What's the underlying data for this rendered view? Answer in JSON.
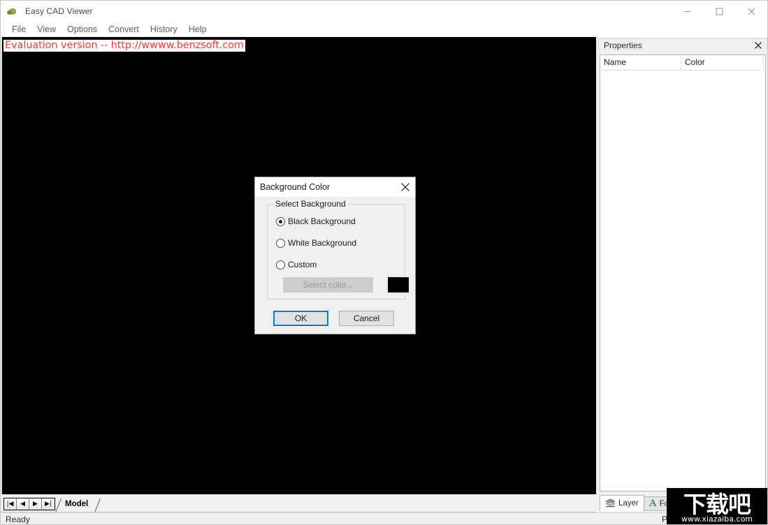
{
  "window": {
    "title": "Easy CAD Viewer",
    "icon": "turtle-icon",
    "controls": {
      "minimize": "minimize-icon",
      "maximize": "maximize-icon",
      "close": "close-icon"
    }
  },
  "menubar": {
    "items": [
      {
        "label": "File"
      },
      {
        "label": "View"
      },
      {
        "label": "Options"
      },
      {
        "label": "Convert"
      },
      {
        "label": "History"
      },
      {
        "label": "Help"
      }
    ]
  },
  "canvas": {
    "evaluation_banner": "Evaluation version -- http://wwww.benzsoft.com",
    "background_color": "#000000",
    "banner_text_color": "#f23a3a"
  },
  "model_strip": {
    "nav_buttons": [
      {
        "name": "first",
        "glyph": "|◀"
      },
      {
        "name": "previous",
        "glyph": "◀"
      },
      {
        "name": "next",
        "glyph": "▶"
      },
      {
        "name": "last",
        "glyph": "▶|"
      }
    ],
    "tab_label": "Model"
  },
  "statusbar": {
    "text": "Ready",
    "right_text": "P"
  },
  "properties": {
    "title": "Properties",
    "close_icon": "close-icon",
    "columns": [
      {
        "label": "Name"
      },
      {
        "label": "Color"
      }
    ],
    "rows": [],
    "tabs": [
      {
        "label": "Layer",
        "icon": "layers-icon",
        "active": true
      },
      {
        "label": "Font",
        "icon": "font-a-icon",
        "active": false
      }
    ]
  },
  "dialog": {
    "title": "Background Color",
    "close_icon": "close-icon",
    "group_label": "Select Background",
    "options": [
      {
        "label": "Black Background",
        "checked": true
      },
      {
        "label": "White Background",
        "checked": false
      },
      {
        "label": "Custom",
        "checked": false
      }
    ],
    "select_color_label": "Select color...",
    "select_color_enabled": false,
    "swatch_color": "#000000",
    "buttons": {
      "ok": "OK",
      "cancel": "Cancel"
    },
    "focused_button": "OK",
    "accent_color": "#0078d7"
  },
  "watermark": {
    "cn_text": "下载吧",
    "url": "www.xiazaiba.com"
  }
}
